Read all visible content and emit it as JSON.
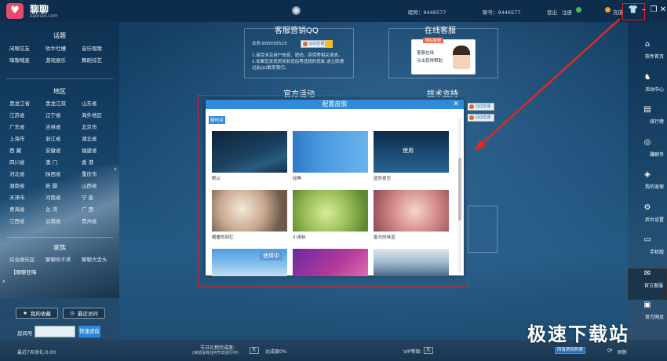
{
  "titlebar": {
    "app_name": "聊聊",
    "app_url": "liaoliao.com",
    "nickname": "昵称：9446577",
    "account": "聊号：9446577",
    "logout": "登出",
    "register": "注册",
    "recharge": "充值"
  },
  "sidebar": {
    "topics_title": "话题",
    "topics": [
      "闲聊交友",
      "吹牛吐槽",
      "音乐唱歌",
      "嗨歌喊麦",
      "游戏娱乐",
      "舞蹈综艺"
    ],
    "regions_title": "地区",
    "regions": [
      "黑龙江省",
      "黑龙江双",
      "山东省",
      "江苏省",
      "辽宁省",
      "海外地区",
      "广东省",
      "吉林省",
      "北京市",
      "上海市",
      "浙江省",
      "湖北省",
      "西  藏",
      "安徽省",
      "福建省",
      "四川省",
      "澳  门",
      "香  港",
      "河北省",
      "陕西省",
      "重庆市",
      "湖南省",
      "新  疆",
      "山西省",
      "天津市",
      "河南省",
      "宁  夏",
      "青海省",
      "台  湾",
      "广  西",
      "江西省",
      "云南省",
      "贵州省"
    ],
    "family_title": "家族",
    "family": [
      "综合娱乐区",
      "聊聊吹不美",
      "聊聊大舌头"
    ],
    "special": "【聊聊狂嗨",
    "favorites": "我的收藏",
    "recent": "最近访问",
    "room_label": "房间号",
    "quick_enter": "快速进房"
  },
  "rsidebar": [
    "软件首页",
    "活动中心",
    "排行榜",
    "赚聊币",
    "我的宠保",
    "后台设置",
    "手机版",
    "官方客服",
    "官方网页"
  ],
  "cards": {
    "qq_title": "客服营销QQ",
    "qq_id": "业务:800035523",
    "qq_btn": "QQ交谈",
    "qq_desc": [
      "1.接受涉及用户信息、密码、资保等相关请求。",
      "2.如果您发现房间有低俗等违规的现象,请立即通",
      "过此QQ联系我们。"
    ],
    "online_title": "在线客服",
    "cs_label": "网站客服",
    "cs_text1": "客服在线",
    "cs_text2": "点击获得帮助",
    "activity_title": "官方活动",
    "tech_title": "技术支持",
    "qq_btn2": "QQ交谈",
    "qq_btn3": "QQ交谈"
  },
  "dialog": {
    "title": "配置皮肤",
    "tag": "聊时间",
    "skins": [
      {
        "label": "默认",
        "use": ""
      },
      {
        "label": "经典",
        "use": ""
      },
      {
        "label": "蓝色夜空",
        "use": "使用"
      },
      {
        "label": "暖暖的回忆",
        "use": ""
      },
      {
        "label": "小清新",
        "use": ""
      },
      {
        "label": "夏天的味道",
        "use": ""
      },
      {
        "label": "",
        "use": "使用中"
      },
      {
        "label": "",
        "use": ""
      },
      {
        "label": "",
        "use": ""
      }
    ]
  },
  "statusbar": {
    "income": "最近7天收礼:0.00",
    "festival": "节日礼物完成度:",
    "festival_sub": "(目前没有任何节日进行中)",
    "none1": "无",
    "achieve": "达成度0%",
    "vip": "VIP等级:",
    "none2": "无",
    "open_list": "所有房间列表",
    "refresh": "刷新"
  },
  "watermark": "极速下载站"
}
